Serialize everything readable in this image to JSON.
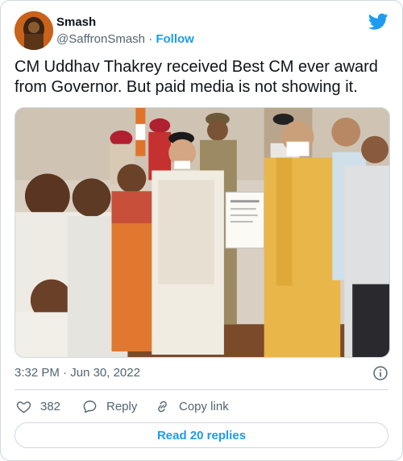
{
  "author": {
    "name": "Smash",
    "handle": "@SaffronSmash",
    "separator": "·",
    "follow_label": "Follow"
  },
  "tweet": {
    "text": "CM Uddhav Thakrey received Best CM ever award from Governor. But paid media is not showing it.",
    "time": "3:32 PM",
    "date_separator": "·",
    "date": "Jun 30, 2022"
  },
  "actions": {
    "like_count": "382",
    "reply_label": "Reply",
    "copy_link_label": "Copy link"
  },
  "replies_button": "Read 20 replies",
  "colors": {
    "accent": "#1d9bf0",
    "secondary_text": "#536471",
    "border": "#cfd9de"
  },
  "icons": {
    "brand": "twitter-bird-icon",
    "info": "info-icon",
    "like": "heart-icon",
    "reply": "speech-bubble-icon",
    "copy": "link-icon"
  }
}
